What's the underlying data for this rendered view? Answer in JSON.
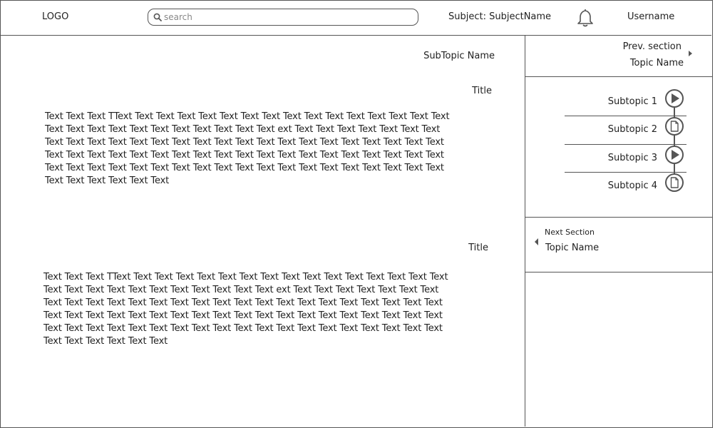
{
  "header": {
    "logo": "LOGO",
    "search_placeholder": "search",
    "subject": "Subject: SubjectName",
    "username": "Username",
    "icons": {
      "search": "search-icon",
      "notifications": "bell-icon"
    }
  },
  "main": {
    "subtopic_name": "SubTopic Name",
    "sections": [
      {
        "title": "Title",
        "body": "Text Text Text TText Text Text Text Text Text Text Text Text Text Text Text Text Text Text Text\nText Text Text Text Text Text Text Text Text Text Text ext Text Text Text Text Text Text Text\nText Text Text Text Text Text Text Text Text Text Text Text Text Text Text Text Text Text Text\nText Text Text Text Text Text Text Text Text Text Text Text Text Text Text Text Text Text Text\nText Text Text Text Text Text Text Text Text Text Text Text Text Text Text Text Text Text Text\nText Text Text Text Text Text"
      },
      {
        "title": "Title",
        "body": "Text Text Text TText Text Text Text Text Text Text Text Text Text Text Text Text Text Text Text\nText Text Text Text Text Text Text Text Text Text Text ext Text Text Text Text Text Text Text\nText Text Text Text Text Text Text Text Text Text Text Text Text Text Text Text Text Text Text\nText Text Text Text Text Text Text Text Text Text Text Text Text Text Text Text Text Text Text\nText Text Text Text Text Text Text Text Text Text Text Text Text Text Text Text Text Text Text\nText Text Text Text Text Text"
      }
    ]
  },
  "sidebar": {
    "prev": {
      "label": "Prev. section",
      "topic": "Topic Name"
    },
    "subtopics": [
      {
        "label": "Subtopic 1",
        "icon": "play-icon"
      },
      {
        "label": "Subtopic 2",
        "icon": "document-icon"
      },
      {
        "label": "Subtopic 3",
        "icon": "play-icon"
      },
      {
        "label": "Subtopic 4",
        "icon": "document-icon"
      }
    ],
    "next": {
      "label": "Next Section",
      "topic": "Topic Name"
    }
  },
  "colors": {
    "line": "#555555",
    "text": "#222222",
    "placeholder": "#888888"
  }
}
